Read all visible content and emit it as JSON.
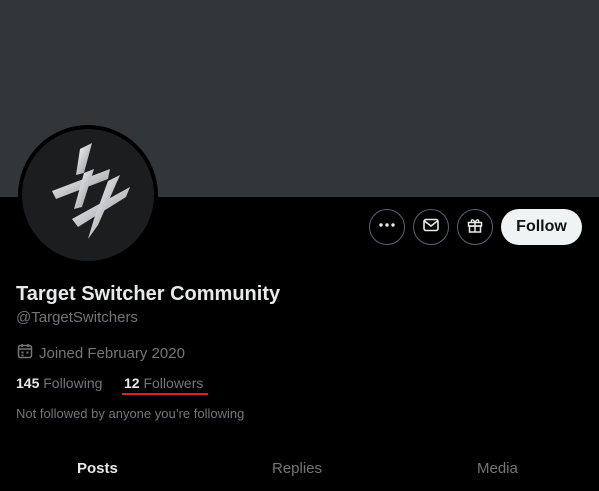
{
  "profile": {
    "name": "Target Switcher Community",
    "handle": "@TargetSwitchers",
    "joined": "Joined February 2020",
    "not_followed_text": "Not followed by anyone you’re following"
  },
  "stats": {
    "following_count": "145",
    "following_label": "Following",
    "followers_count": "12",
    "followers_label": "Followers"
  },
  "actions": {
    "follow_label": "Follow",
    "icons": [
      "more-icon",
      "message-icon",
      "gift-icon"
    ]
  },
  "tabs": [
    {
      "label": "Posts",
      "active": true
    },
    {
      "label": "Replies",
      "active": false
    },
    {
      "label": "Media",
      "active": false
    }
  ],
  "colors": {
    "background": "#000000",
    "banner": "#333639",
    "text_primary": "#e7e9ea",
    "text_secondary": "#71767b",
    "follow_button": "#eff3f4",
    "highlight_underline": "#e0221e"
  }
}
